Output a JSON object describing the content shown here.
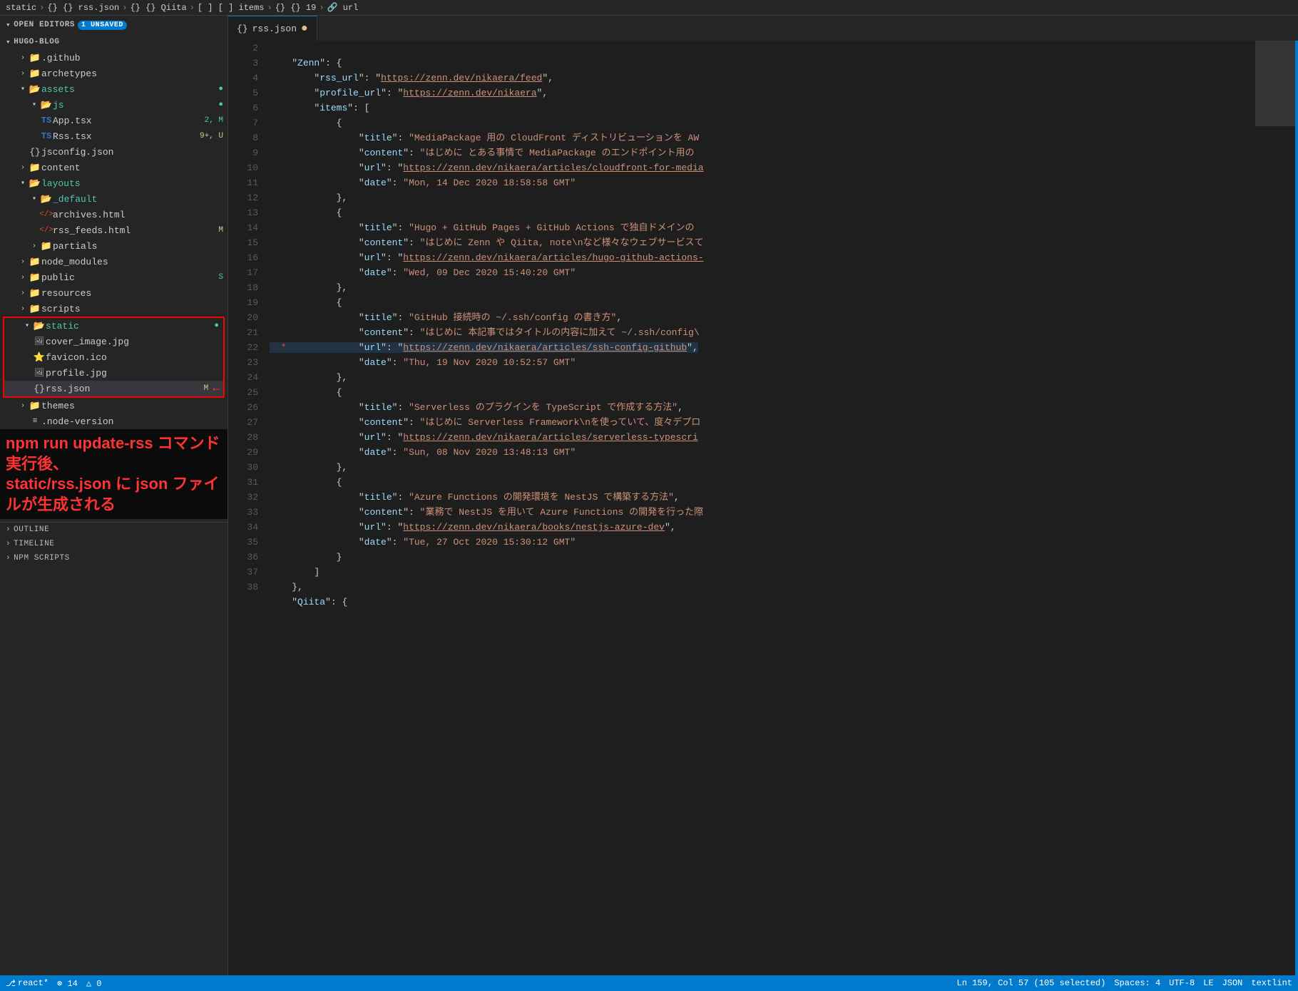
{
  "topbar": {
    "breadcrumbs": [
      "static",
      "{} rss.json",
      "{} Qiita",
      "[ ] items",
      "{} 19",
      "url"
    ]
  },
  "sidebar": {
    "open_editors_label": "OPEN EDITORS",
    "unsaved_count": "1 UNSAVED",
    "project_name": "HUGO-BLOG",
    "github_label": ".github",
    "archetypes_label": "archetypes",
    "assets_label": "assets",
    "js_label": "js",
    "app_tsx_label": "App.tsx",
    "app_tsx_badge": "2, M",
    "rss_tsx_label": "Rss.tsx",
    "rss_tsx_badge": "9+, U",
    "jsconfig_label": "jsconfig.json",
    "content_label": "content",
    "layouts_label": "layouts",
    "default_label": "_default",
    "archives_label": "archives.html",
    "rss_feeds_label": "rss_feeds.html",
    "rss_feeds_badge": "M",
    "partials_label": "partials",
    "node_modules_label": "node_modules",
    "public_label": "public",
    "public_badge": "S",
    "resources_label": "resources",
    "scripts_label": "scripts",
    "static_label": "static",
    "cover_image_label": "cover_image.jpg",
    "favicon_label": "favicon.ico",
    "profile_label": "profile.jpg",
    "rss_json_label": "rss.json",
    "rss_json_badge": "M",
    "themes_label": "themes",
    "node_version_label": ".node-version",
    "outline_label": "OUTLINE",
    "timeline_label": "TIMELINE",
    "npm_scripts_label": "NPM SCRIPTS"
  },
  "annotation": {
    "line1": "npm run update-rss コマンド実行後、",
    "line2": "static/rss.json に json ファイルが生成される"
  },
  "editor": {
    "tab_label": "rss.json",
    "tab_modified": true
  },
  "code": {
    "lines": [
      {
        "num": 2,
        "content": "    \"Zenn\": {",
        "type": "normal"
      },
      {
        "num": 3,
        "content": "        \"rss_url\": \"https://zenn.dev/nikaera/feed\",",
        "type": "url_line",
        "key": "rss_url",
        "url": "https://zenn.dev/nikaera/feed"
      },
      {
        "num": 4,
        "content": "        \"profile_url\": \"https://zenn.dev/nikaera\",",
        "type": "url_line",
        "key": "profile_url",
        "url": "https://zenn.dev/nikaera"
      },
      {
        "num": 5,
        "content": "        \"items\": [",
        "type": "normal"
      },
      {
        "num": 6,
        "content": "            {",
        "type": "normal"
      },
      {
        "num": 7,
        "content": "                \"title\": \"MediaPackage 用の CloudFront ディストリビューションを AW",
        "type": "normal"
      },
      {
        "num": 8,
        "content": "                \"content\": \"はじめに とある事情で MediaPackage のエンドポイント用の",
        "type": "normal"
      },
      {
        "num": 9,
        "content": "                \"url\": \"https://zenn.dev/nikaera/articles/cloudfront-for-media",
        "type": "url_val"
      },
      {
        "num": 10,
        "content": "                \"date\": \"Mon, 14 Dec 2020 18:58:58 GMT\"",
        "type": "normal"
      },
      {
        "num": 11,
        "content": "            },",
        "type": "normal"
      },
      {
        "num": 12,
        "content": "            {",
        "type": "normal"
      },
      {
        "num": 13,
        "content": "                \"title\": \"Hugo + GitHub Pages + GitHub Actions で独自ドメインの",
        "type": "normal"
      },
      {
        "num": 14,
        "content": "                \"content\": \"はじめに Zenn や Qiita, note\\nなど様々なウェブサービスて",
        "type": "normal"
      },
      {
        "num": 15,
        "content": "                \"url\": \"https://zenn.dev/nikaera/articles/hugo-github-actions-",
        "type": "url_val"
      },
      {
        "num": 16,
        "content": "                \"date\": \"Wed, 09 Dec 2020 15:40:20 GMT\"",
        "type": "normal"
      },
      {
        "num": 17,
        "content": "            },",
        "type": "normal"
      },
      {
        "num": 18,
        "content": "            {",
        "type": "normal"
      },
      {
        "num": 19,
        "content": "                \"title\": \"GitHub 接続時の ~/.ssh/config の書き方\",",
        "type": "normal"
      },
      {
        "num": 20,
        "content": "                \"content\": \"はじめに 本記事ではタイトルの内容に加えて ~/.ssh/config\\",
        "type": "normal"
      },
      {
        "num": 21,
        "content": "  *             \"url\": \"https://zenn.dev/nikaera/articles/ssh-config-github\",",
        "type": "selected_dot"
      },
      {
        "num": 22,
        "content": "                \"date\": \"Thu, 19 Nov 2020 10:52:57 GMT\"",
        "type": "normal"
      },
      {
        "num": 23,
        "content": "            },",
        "type": "normal"
      },
      {
        "num": 24,
        "content": "            {",
        "type": "normal"
      },
      {
        "num": 25,
        "content": "                \"title\": \"Serverless のプラグインを TypeScript で作成する方法\",",
        "type": "normal"
      },
      {
        "num": 26,
        "content": "                \"content\": \"はじめに Serverless Framework\\nを使っていて、度々デプロ",
        "type": "normal"
      },
      {
        "num": 27,
        "content": "                \"url\": \"https://zenn.dev/nikaera/articles/serverless-typescri",
        "type": "url_val"
      },
      {
        "num": 28,
        "content": "                \"date\": \"Sun, 08 Nov 2020 13:48:13 GMT\"",
        "type": "normal"
      },
      {
        "num": 29,
        "content": "            },",
        "type": "normal"
      },
      {
        "num": 30,
        "content": "            {",
        "type": "normal"
      },
      {
        "num": 31,
        "content": "                \"title\": \"Azure Functions の開発環境を NestJS で構築する方法\",",
        "type": "normal"
      },
      {
        "num": 32,
        "content": "                \"content\": \"業務で NestJS を用いて Azure Functions の開発を行った際",
        "type": "normal"
      },
      {
        "num": 33,
        "content": "                \"url\": \"https://zenn.dev/nikaera/books/nestjs-azure-dev\",",
        "type": "url_val"
      },
      {
        "num": 34,
        "content": "                \"date\": \"Tue, 27 Oct 2020 15:30:12 GMT\"",
        "type": "normal"
      },
      {
        "num": 35,
        "content": "            }",
        "type": "normal"
      },
      {
        "num": 36,
        "content": "        ]",
        "type": "normal"
      },
      {
        "num": 37,
        "content": "    },",
        "type": "normal"
      },
      {
        "num": 38,
        "content": "    \"Qiita\": {",
        "type": "normal"
      }
    ]
  },
  "statusbar": {
    "branch": "react*",
    "errors": "⊗ 14",
    "warnings": "△ 0",
    "line_col": "Ln 159, Col 57 (105 selected)",
    "spaces": "Spaces: 4",
    "encoding": "UTF-8",
    "line_ending": "LE",
    "language": "JSON",
    "textlint": "textlint"
  }
}
